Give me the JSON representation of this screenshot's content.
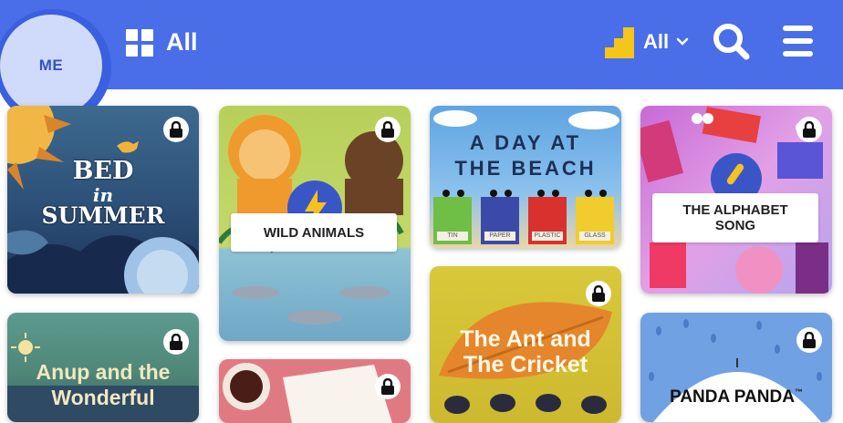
{
  "header": {
    "avatar_label": "ME",
    "category_filter_label": "All",
    "level_filter_label": "All",
    "bg_color": "#4a6ee8",
    "icons": [
      "grid-icon",
      "level-stairs-icon",
      "chevron-down-icon",
      "search-icon",
      "menu-icon"
    ]
  },
  "books": [
    {
      "line1": "BED",
      "line2": "in",
      "line3": "SUMMER",
      "locked": true
    },
    {
      "title": "WILD ANIMALS",
      "locked": true
    },
    {
      "line1": "A DAY AT",
      "line2": "THE BEACH",
      "bins": [
        "TIN",
        "PAPER",
        "PLASTIC",
        "GLASS"
      ],
      "locked": false
    },
    {
      "line1": "THE ALPHABET",
      "line2": "SONG",
      "locked": true
    },
    {
      "line1": "Anup and the",
      "line2": "Wonderful",
      "locked": true
    },
    {
      "locked": true
    },
    {
      "line1": "The Ant and",
      "line2": "The Cricket",
      "locked": true
    },
    {
      "title": "PANDA PANDA",
      "trademark": "™",
      "locked": true
    }
  ]
}
